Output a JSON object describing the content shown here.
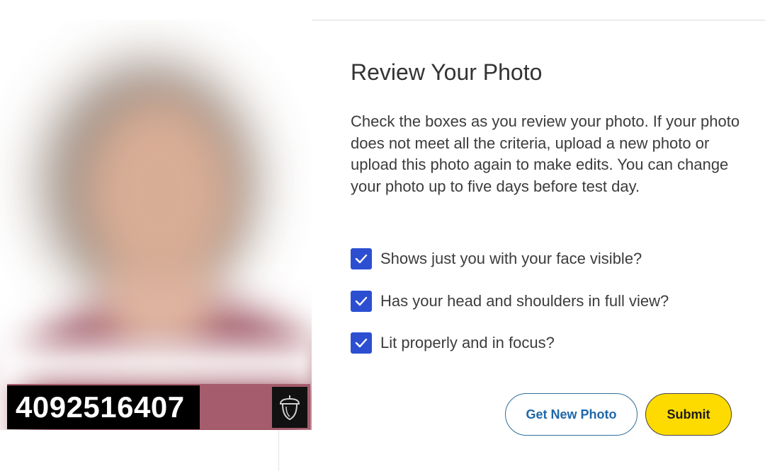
{
  "photo": {
    "id_number": "4092516407",
    "badge_icon": "acorn-icon"
  },
  "review": {
    "title": "Review Your Photo",
    "intro": "Check the boxes as you review your photo. If your photo does not meet all the criteria, upload a new photo or upload this photo again to make edits. You can change your photo up to five days before test day.",
    "criteria": [
      {
        "label": "Shows just you with your face visible?",
        "checked": true
      },
      {
        "label": "Has your head and shoulders in full view?",
        "checked": true
      },
      {
        "label": "Lit properly and in focus?",
        "checked": true
      }
    ]
  },
  "actions": {
    "get_new_photo": "Get New Photo",
    "submit": "Submit"
  },
  "colors": {
    "checkbox": "#2c4fd1",
    "submit_bg": "#fedb00",
    "secondary_text": "#1f67a8"
  }
}
